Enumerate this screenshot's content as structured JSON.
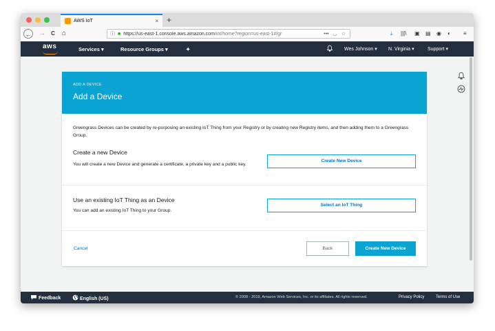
{
  "browser": {
    "tab_title": "AWS IoT",
    "tab_close": "×",
    "new_tab": "+",
    "url_host": "https://us-east-1.console.aws.amazon.com",
    "url_path": "/iot/home?region=us-east-1#/gr",
    "url_more": "•••",
    "icons": {
      "back": "←",
      "forward": "→",
      "reload": "C",
      "home": "⌂",
      "info": "ⓘ",
      "lock": "🔒",
      "pocket": "◡",
      "bookmark": "☆",
      "download": "⤓",
      "library": "|||\\",
      "reader": "▣",
      "screenshot": "▤",
      "account": "◉",
      "extension": "◐",
      "menu": "≡"
    },
    "lights": [
      "#fc605c",
      "#fdbc40",
      "#34c749"
    ]
  },
  "aws_header": {
    "logo": "aws",
    "services": "Services",
    "resource_groups": "Resource Groups",
    "pin_icon": "✦",
    "bell_icon": "🔔",
    "user": "Wes Johnson",
    "region": "N. Virginia",
    "support": "Support",
    "caret": "▾"
  },
  "side_icons": {
    "bell": "🔔",
    "pulse": "⊘"
  },
  "card": {
    "eyebrow": "ADD A DEVICE",
    "title": "Add a Device",
    "intro": "Greengrass Devices can be created by re-purposing an existing IoT Thing from your Registry or by creating new Registry items, and then adding them to a Greengrass Group.",
    "section1": {
      "title": "Create a new Device",
      "desc": "You will create a new Device and generate a certificate, a private key and a public key.",
      "button": "Create New Device"
    },
    "section2": {
      "title": "Use an existing IoT Thing as an Device",
      "desc": "You can add an existing IoT Thing to your Group.",
      "button": "Select an IoT Thing"
    },
    "cancel": "Cancel",
    "back": "Back",
    "primary": "Create New Device"
  },
  "footer": {
    "feedback_icon": "💬",
    "feedback": "Feedback",
    "globe_icon": "🌐",
    "language": "English (US)",
    "copyright": "© 2008 - 2019, Amazon Web Services, Inc. or its affiliates. All rights reserved.",
    "privacy": "Privacy Policy",
    "terms": "Terms of Use"
  },
  "colors": {
    "accent": "#0aa4d3",
    "header": "#232f3e",
    "link": "#0073bb",
    "aws_orange": "#ff9900"
  }
}
